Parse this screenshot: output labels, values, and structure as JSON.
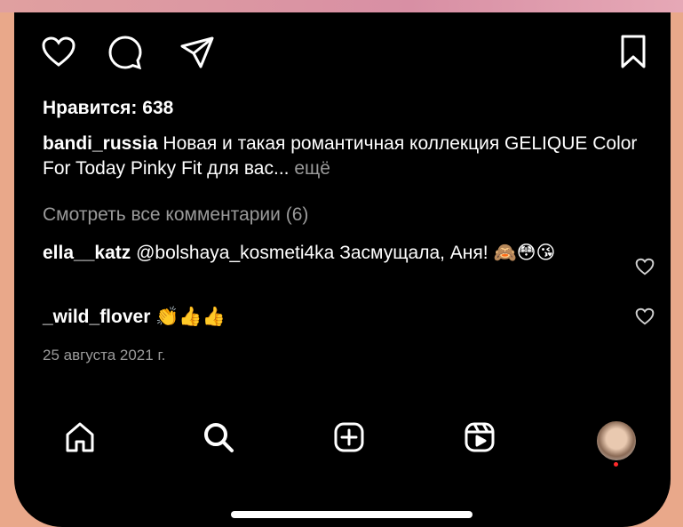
{
  "post": {
    "likes_text": "Нравится: 638",
    "caption": {
      "username": "bandi_russia",
      "text": "Новая и такая романтичная коллекция GELIQUE Color For Today Pinky Fit для вас...",
      "more": "ещё"
    },
    "view_all_comments": "Смотреть все комментарии (6)",
    "comments": [
      {
        "username": "ella__katz",
        "text": "@bolshaya_kosmeti4ka Засмущала, Аня!",
        "emoji": "🙈😳😘"
      },
      {
        "username": "_wild_flover",
        "text": "",
        "emoji": "👏👍👍"
      }
    ],
    "date": "25 августа 2021 г."
  },
  "actions": {
    "icons": [
      "heart-icon",
      "comment-icon",
      "share-icon",
      "bookmark-icon"
    ]
  },
  "tabbar": {
    "icons": [
      "home-icon",
      "search-icon",
      "new-post-icon",
      "reels-icon",
      "profile-avatar"
    ],
    "notification_dot_color": "#ff2a2a"
  },
  "colors": {
    "background": "#000000",
    "text": "#ffffff",
    "muted": "#9a9a9a",
    "frame": "#e9a88a"
  }
}
